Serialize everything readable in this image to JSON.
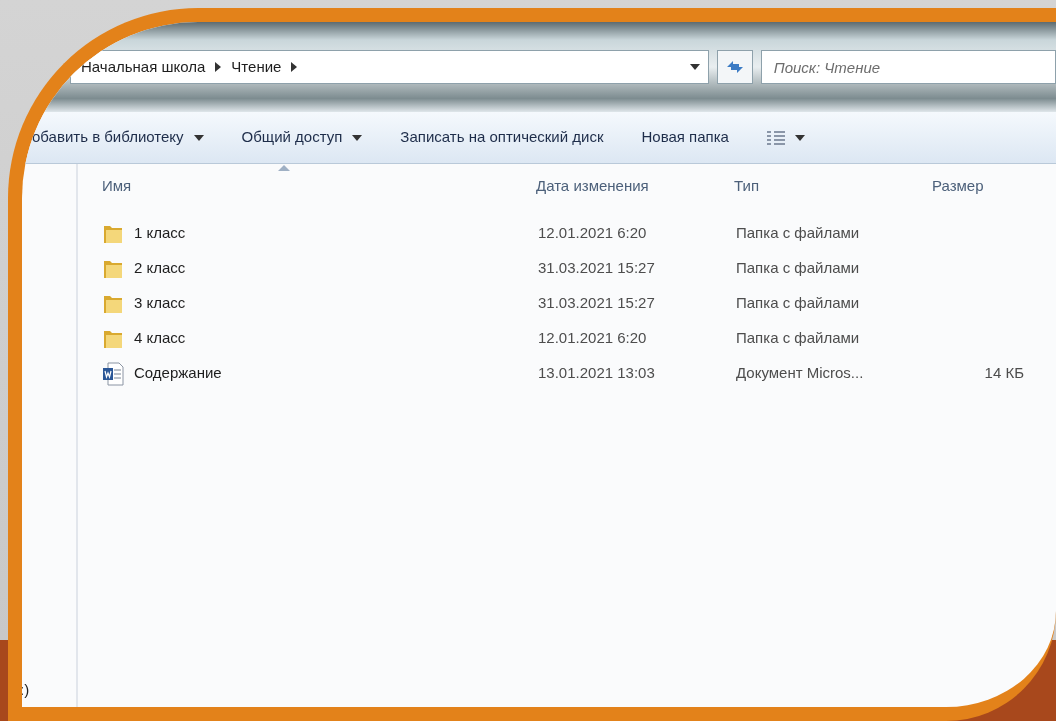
{
  "address_bar": {
    "breadcrumbs": [
      "Начальная школа",
      "Чтение"
    ]
  },
  "search": {
    "placeholder": "Поиск: Чтение"
  },
  "toolbar": [
    {
      "kind": "menu",
      "label": "обавить в библиотеку",
      "dropdown": true
    },
    {
      "kind": "menu",
      "label": "Общий доступ",
      "dropdown": true
    },
    {
      "kind": "menu",
      "label": "Записать на оптический диск",
      "dropdown": false
    },
    {
      "kind": "menu",
      "label": "Новая папка",
      "dropdown": false
    },
    {
      "kind": "view",
      "dropdown": true
    }
  ],
  "columns": [
    {
      "label": "Имя",
      "sorted": true
    },
    {
      "label": "Дата изменения",
      "sorted": false
    },
    {
      "label": "Тип",
      "sorted": false
    },
    {
      "label": "Размер",
      "sorted": false
    }
  ],
  "files": [
    {
      "kind": "folder",
      "name": "1 класс",
      "date": "12.01.2021 6:20",
      "type": "Папка с файлами"
    },
    {
      "kind": "folder",
      "name": "2 класс",
      "date": "31.03.2021 15:27",
      "type": "Папка с файлами"
    },
    {
      "kind": "folder",
      "name": "3 класс",
      "date": "31.03.2021 15:27",
      "type": "Папка с файлами"
    },
    {
      "kind": "folder",
      "name": "4  класс",
      "date": "12.01.2021 6:20",
      "type": "Папка с файлами"
    },
    {
      "kind": "document",
      "name": "Содержание",
      "date": "13.01.2021 13:03",
      "type": "Документ Micros...",
      "size": "14 КБ"
    }
  ],
  "nav_pane": {
    "text": ":)"
  }
}
